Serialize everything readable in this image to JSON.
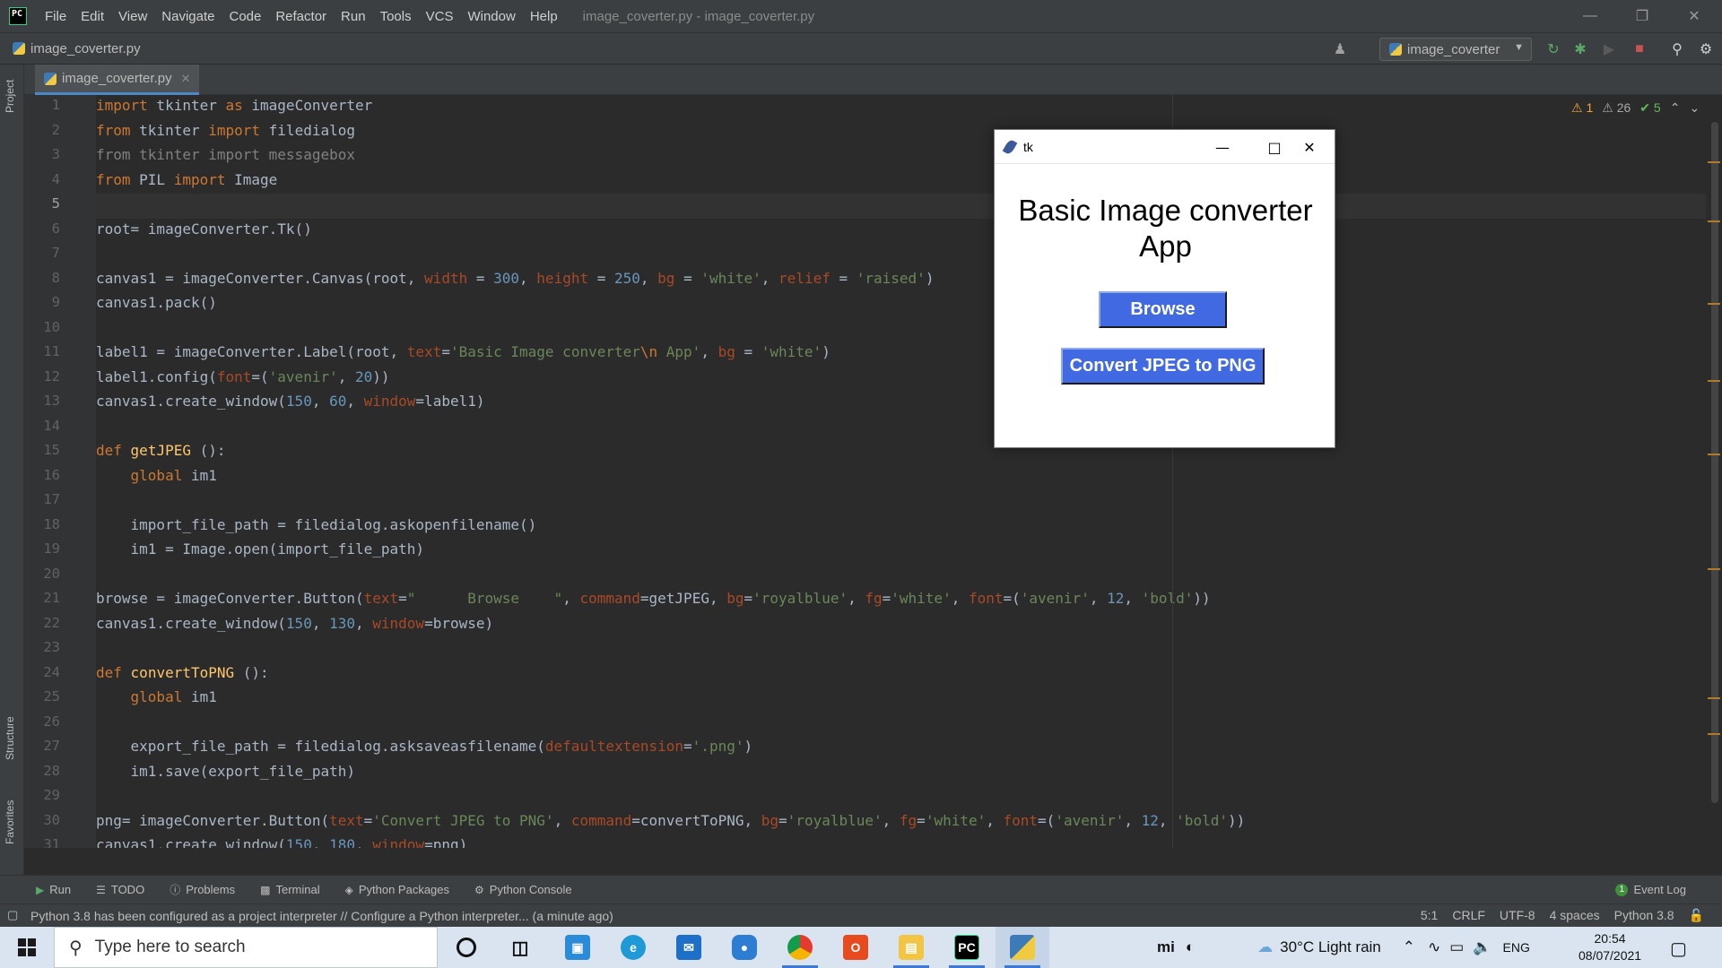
{
  "titlebar": {
    "menu": [
      "File",
      "Edit",
      "View",
      "Navigate",
      "Code",
      "Refactor",
      "Run",
      "Tools",
      "VCS",
      "Window",
      "Help"
    ],
    "window_title": "image_coverter.py - image_coverter.py"
  },
  "navbar": {
    "file": "image_coverter.py",
    "run_config": "image_coverter"
  },
  "tabs": [
    {
      "label": "image_coverter.py"
    }
  ],
  "left_strip": {
    "project": "Project",
    "structure": "Structure",
    "favorites": "Favorites"
  },
  "inspections": {
    "warnings": "1",
    "weak_warnings": "26",
    "typos": "5"
  },
  "editor": {
    "line_numbers": [
      "1",
      "2",
      "3",
      "4",
      "5",
      "6",
      "7",
      "8",
      "9",
      "10",
      "11",
      "12",
      "13",
      "14",
      "15",
      "16",
      "17",
      "18",
      "19",
      "20",
      "21",
      "22",
      "23",
      "24",
      "25",
      "26",
      "27",
      "28",
      "29",
      "30",
      "31"
    ],
    "current_line": 5
  },
  "tk_window": {
    "title": "tk",
    "label": "Basic Image converter\nApp",
    "browse": "Browse",
    "convert": "Convert JPEG to PNG",
    "button_color": "#4169e1"
  },
  "bottom_tools": {
    "run": "Run",
    "todo": "TODO",
    "problems": "Problems",
    "terminal": "Terminal",
    "packages": "Python Packages",
    "console": "Python Console",
    "event_log": "Event Log",
    "event_count": "1"
  },
  "status": {
    "message": "Python 3.8 has been configured as a project interpreter // Configure a Python interpreter... (a minute ago)",
    "position": "5:1",
    "line_sep": "CRLF",
    "encoding": "UTF-8",
    "indent": "4 spaces",
    "interpreter": "Python 3.8"
  },
  "taskbar": {
    "search_placeholder": "Type here to search",
    "weather": "30°C  Light rain",
    "lang": "ENG",
    "time": "20:54",
    "date": "08/07/2021"
  }
}
